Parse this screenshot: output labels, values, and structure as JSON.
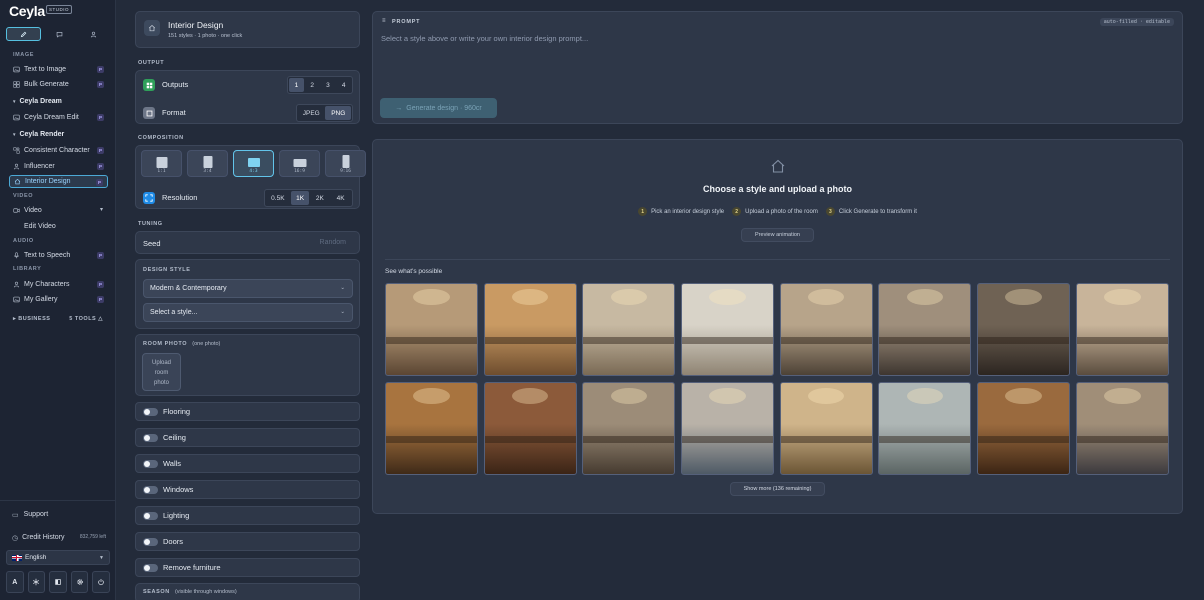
{
  "app": {
    "name": "Ceyla",
    "badge": "STUDIO"
  },
  "sidebar": {
    "modes": [
      {
        "icon": "pencil-icon",
        "active": true
      },
      {
        "icon": "chat-icon",
        "active": false
      },
      {
        "icon": "person-icon",
        "active": false
      }
    ],
    "sections": {
      "image": "IMAGE",
      "video": "VIDEO",
      "audio": "AUDIO",
      "library": "LIBRARY",
      "business": "BUSINESS",
      "business_tools": "5 TOOLS"
    },
    "groups": {
      "dream": "Ceyla Dream",
      "render": "Ceyla Render"
    },
    "items": {
      "text_to_image": "Text to Image",
      "bulk_generate": "Bulk Generate",
      "dream_edit": "Ceyla Dream Edit",
      "consistent_character": "Consistent Character",
      "influencer": "Influencer",
      "interior_design": "Interior Design",
      "video": "Video",
      "edit_video": "Edit Video",
      "text_to_speech": "Text to Speech",
      "my_characters": "My Characters",
      "my_gallery": "My Gallery"
    },
    "pro_badge": "P",
    "support": "Support",
    "credit_history": "Credit History",
    "credits_left": "832,759 left",
    "language": "English",
    "bottom_a": "A"
  },
  "tool": {
    "title": "Interior Design",
    "subtitle": "151 styles · 1 photo · one click"
  },
  "output": {
    "section": "OUTPUT",
    "outputs_label": "Outputs",
    "outputs_options": [
      "1",
      "2",
      "3",
      "4"
    ],
    "outputs_selected": "1",
    "format_label": "Format",
    "format_options": [
      "JPEG",
      "PNG"
    ],
    "format_selected": "PNG"
  },
  "composition": {
    "section": "COMPOSITION",
    "ratios": [
      "1:1",
      "3:4",
      "4:3",
      "16:9",
      "9:16"
    ],
    "ratio_selected": "4:3",
    "resolution_label": "Resolution",
    "resolution_options": [
      "0.5K",
      "1K",
      "2K",
      "4K"
    ],
    "resolution_selected": "1K"
  },
  "tuning": {
    "section": "TUNING",
    "seed_label": "Seed",
    "seed_placeholder": "Random"
  },
  "design_style": {
    "section": "DESIGN STYLE",
    "category": "Modern & Contemporary",
    "style_placeholder": "Select a style..."
  },
  "room_photo": {
    "section": "ROOM PHOTO",
    "hint": "(one photo)",
    "upload_line1": "Upload",
    "upload_line2": "room",
    "upload_line3": "photo"
  },
  "toggles": [
    "Flooring",
    "Ceiling",
    "Walls",
    "Windows",
    "Lighting",
    "Doors",
    "Remove furniture"
  ],
  "season": {
    "section": "SEASON",
    "hint": "(visible through windows)"
  },
  "prompt": {
    "title": "PROMPT",
    "badge": "auto-filled · editable",
    "placeholder": "Select a style above or write your own interior design prompt...",
    "generate": "Generate design · 960cr"
  },
  "empty_state": {
    "title": "Choose a style and upload a photo",
    "steps": [
      "Pick an interior design style",
      "Upload a photo of the room",
      "Click Generate to transform it"
    ],
    "preview": "Preview animation"
  },
  "gallery": {
    "title": "See what's possible",
    "show_more": "Show more (136 remaining)",
    "thumb_colors": [
      [
        "#b69a78",
        "#5b4633"
      ],
      [
        "#c99a63",
        "#6e4d2e"
      ],
      [
        "#c7b9a2",
        "#7a6a55"
      ],
      [
        "#d8d3c8",
        "#8f8473"
      ],
      [
        "#b7a48a",
        "#4d4236"
      ],
      [
        "#9f8f7c",
        "#3e3630"
      ],
      [
        "#6f6254",
        "#2c2520"
      ],
      [
        "#c8b49a",
        "#5a4c3e"
      ],
      [
        "#a8743f",
        "#3f2a18"
      ],
      [
        "#8c5a3a",
        "#3b2416"
      ],
      [
        "#9c8c78",
        "#463b30"
      ],
      [
        "#b9b2a8",
        "#4e5a66"
      ],
      [
        "#cfb48a",
        "#6b5535"
      ],
      [
        "#aeb6b5",
        "#5b6564"
      ],
      [
        "#9a6a3e",
        "#3c2514"
      ],
      [
        "#a08e78",
        "#3c3a3e"
      ]
    ]
  }
}
